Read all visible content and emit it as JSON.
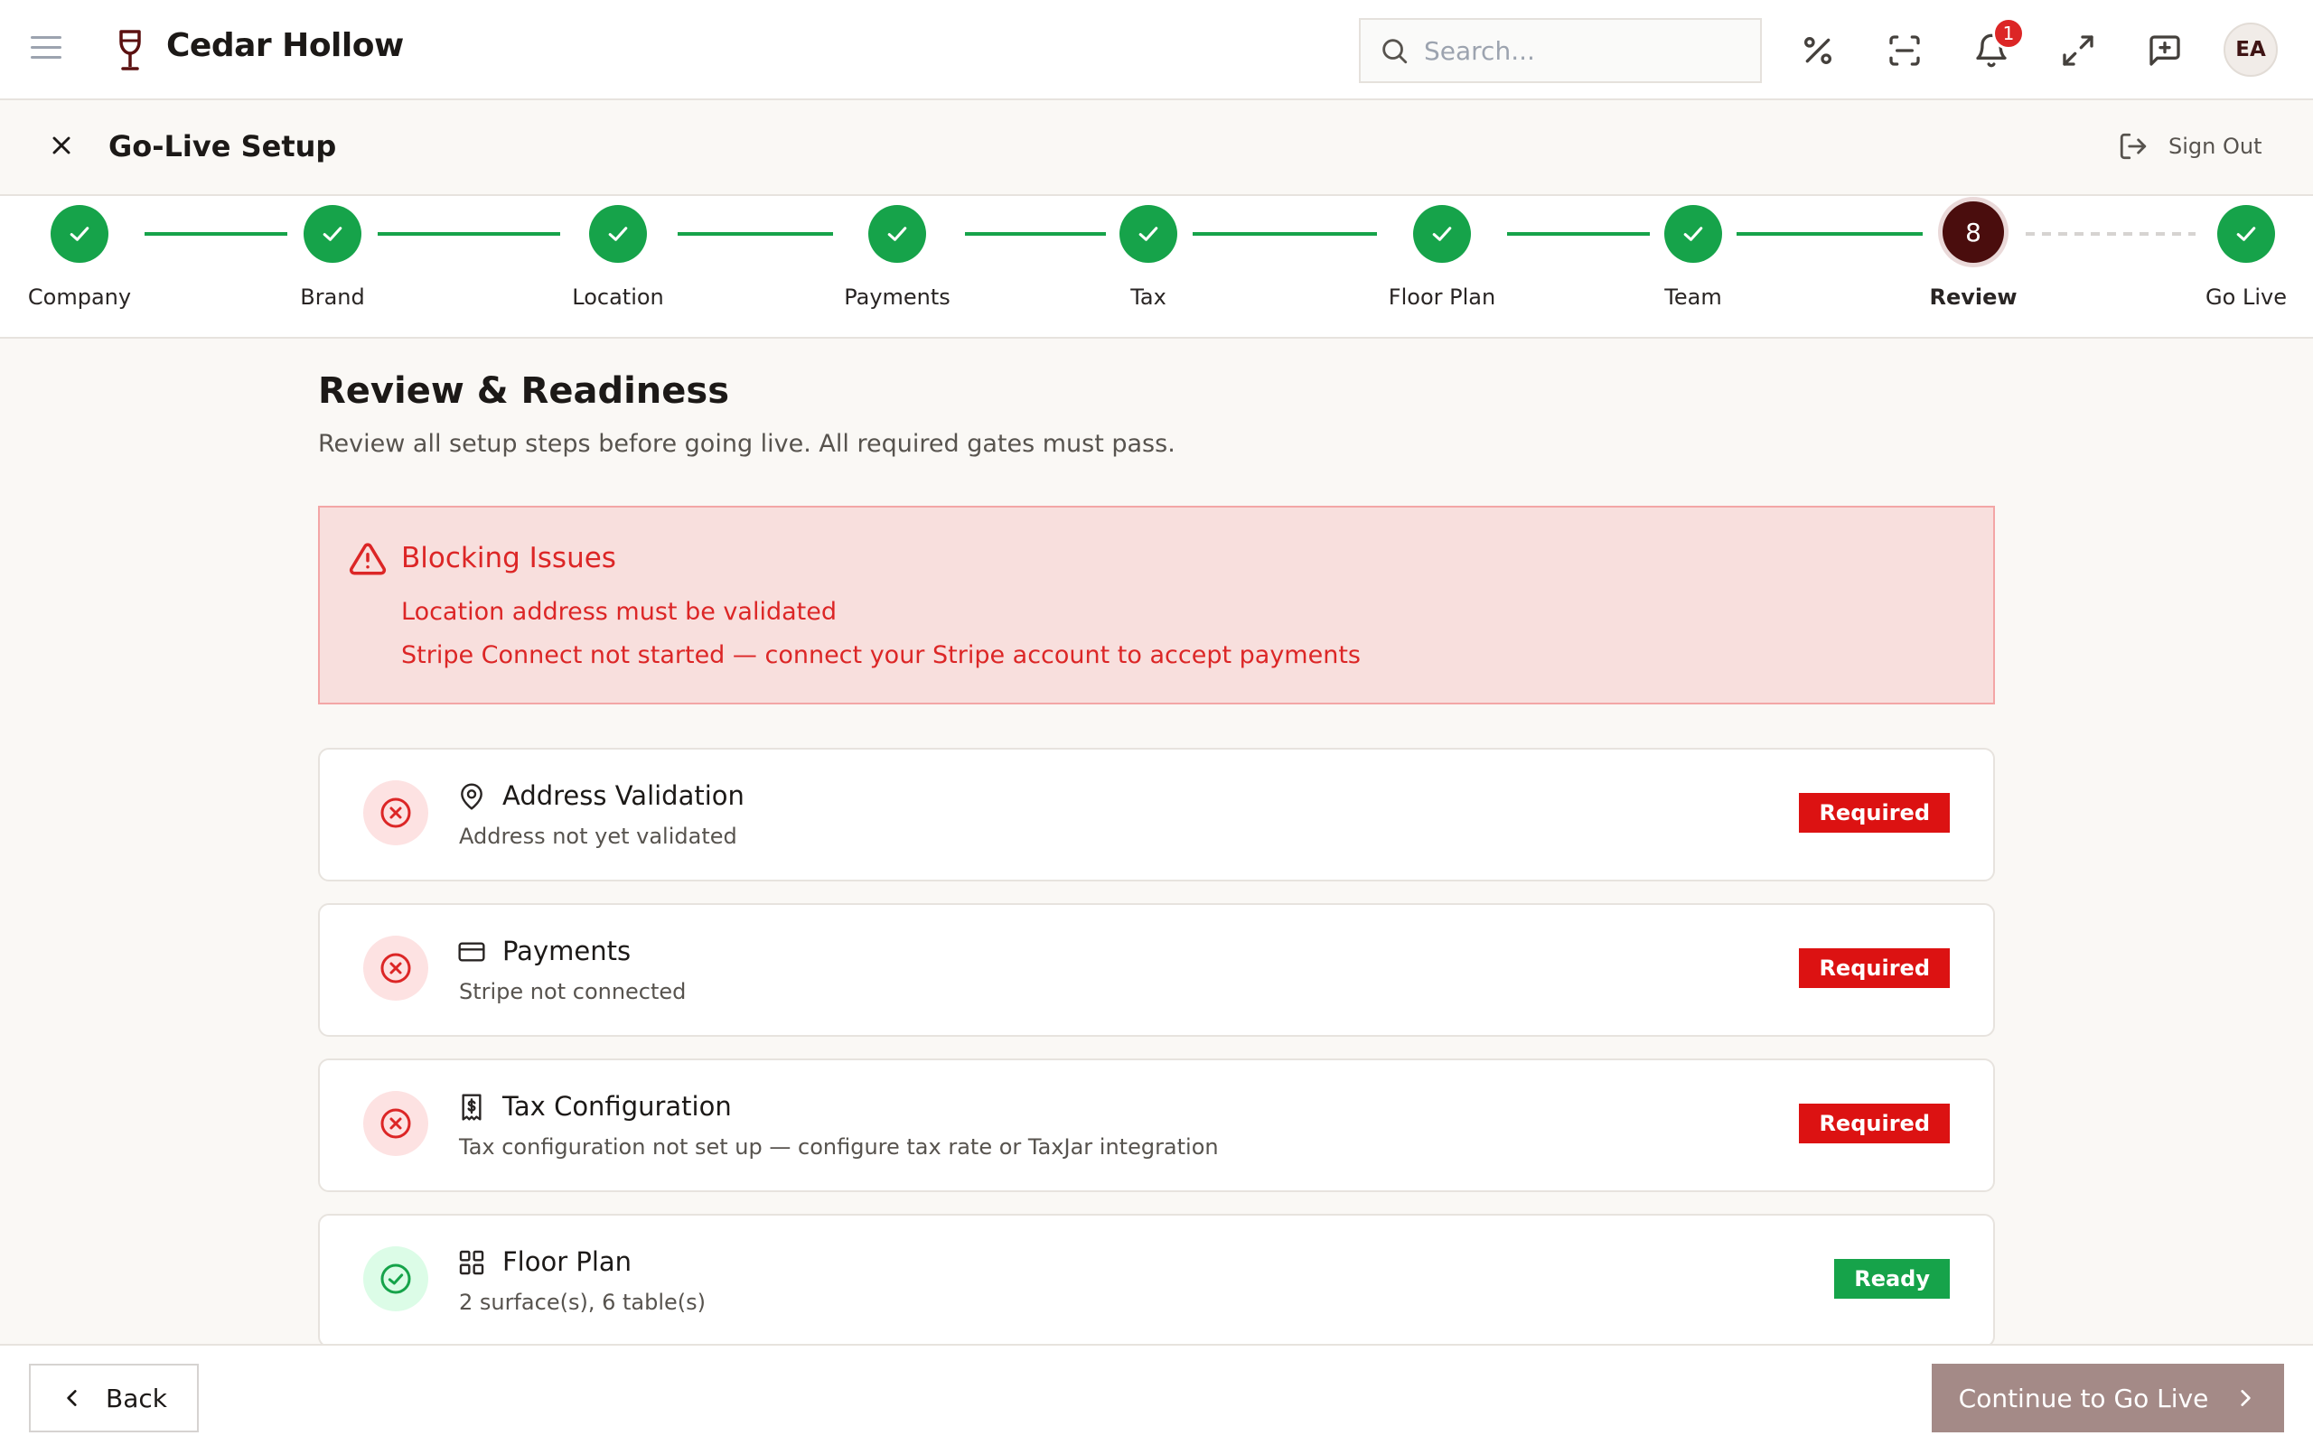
{
  "app": {
    "name": "Cedar Hollow",
    "search_placeholder": "Search...",
    "notification_count": "1",
    "avatar_initials": "EA"
  },
  "subheader": {
    "title": "Go-Live Setup",
    "sign_out": "Sign Out"
  },
  "stepper": {
    "steps": [
      {
        "label": "Company",
        "status": "done"
      },
      {
        "label": "Brand",
        "status": "done"
      },
      {
        "label": "Location",
        "status": "done"
      },
      {
        "label": "Payments",
        "status": "done"
      },
      {
        "label": "Tax",
        "status": "done"
      },
      {
        "label": "Floor Plan",
        "status": "done"
      },
      {
        "label": "Team",
        "status": "done"
      },
      {
        "label": "Review",
        "status": "current",
        "number": "8"
      },
      {
        "label": "Go Live",
        "status": "done"
      }
    ]
  },
  "page": {
    "title": "Review & Readiness",
    "subtitle": "Review all setup steps before going live. All required gates must pass."
  },
  "alert": {
    "title": "Blocking Issues",
    "issues": [
      "Location address must be validated",
      "Stripe Connect not started — connect your Stripe account to accept payments"
    ]
  },
  "gates": [
    {
      "title": "Address Validation",
      "description": "Address not yet validated",
      "status": "Required",
      "icon": "map-pin-icon"
    },
    {
      "title": "Payments",
      "description": "Stripe not connected",
      "status": "Required",
      "icon": "credit-card-icon"
    },
    {
      "title": "Tax Configuration",
      "description": "Tax configuration not set up — configure tax rate or TaxJar integration",
      "status": "Required",
      "icon": "receipt-icon"
    },
    {
      "title": "Floor Plan",
      "description": "2 surface(s), 6 table(s)",
      "status": "Ready",
      "icon": "grid-icon"
    }
  ],
  "footer": {
    "back_label": "Back",
    "continue_label": "Continue to Go Live"
  },
  "colors": {
    "success": "#16a34a",
    "danger": "#dc2626",
    "brand": "#4a0d0d",
    "continue_button": "#a48a87"
  }
}
